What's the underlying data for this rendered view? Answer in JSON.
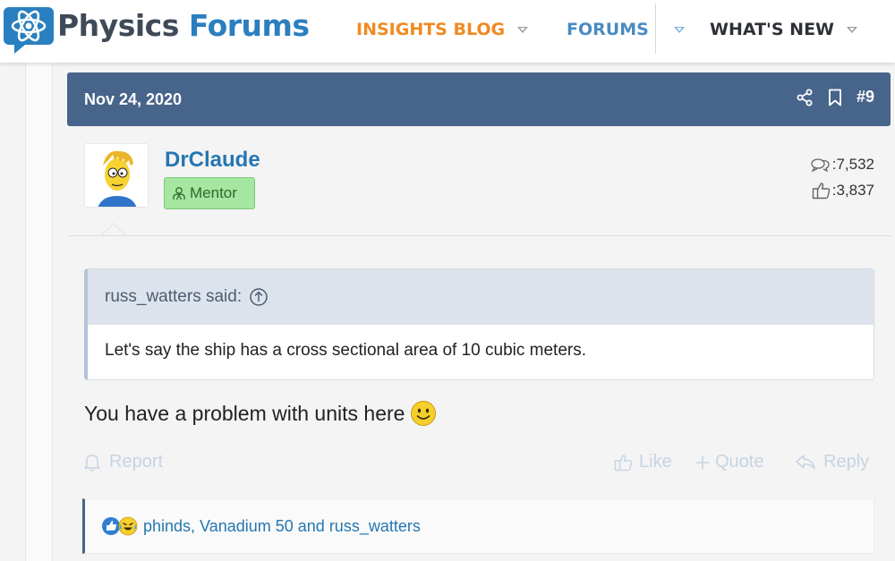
{
  "site": {
    "name_part1": "Physics",
    "name_part2": "Forums"
  },
  "nav": {
    "insights": "INSIGHTS BLOG",
    "forums": "FORUMS",
    "whats_new": "WHAT'S NEW"
  },
  "post": {
    "date": "Nov 24, 2020",
    "number": "#9",
    "author": {
      "name": "DrClaude",
      "role": "Mentor",
      "messages": ":7,532",
      "reactions": ":3,837"
    },
    "quote": {
      "attribution": "russ_watters said:",
      "text": "Let's say the ship has a cross sectional area of 10 cubic meters."
    },
    "body": "You have a problem with units here",
    "actions": {
      "report": "Report",
      "like": "Like",
      "quote": "Quote",
      "reply": "Reply"
    },
    "reactions_text": "phinds, Vanadium 50 and russ_watters"
  },
  "colors": {
    "brand_blue": "#2a7fc0",
    "brand_dark": "#3e4a57",
    "insights_orange": "#f08a22",
    "post_header": "#47648a",
    "mentor_badge": "#a5e6a0",
    "link": "#2577b1"
  },
  "icons": {
    "share": "share-icon",
    "bookmark": "bookmark-icon",
    "messages": "chat-bubbles-icon",
    "reactions": "thumbs-up-icon",
    "mentor": "mentor-icon",
    "quote_link": "arrow-up-circle-icon",
    "smiley": "smiley-emoji",
    "report": "bell-icon",
    "like": "thumbs-up-icon",
    "quote": "plus-icon",
    "reply": "reply-arrow-icon"
  }
}
